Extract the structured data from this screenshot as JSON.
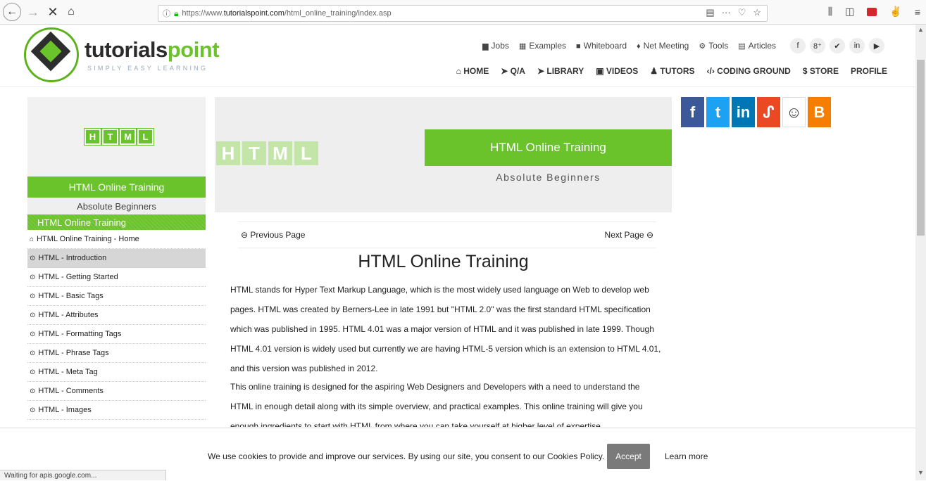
{
  "browser": {
    "url_prefix": "https://www.",
    "url_domain": "tutorialspoint.com",
    "url_path": "/html_online_training/index.asp",
    "status_text": "Waiting for apis.google.com..."
  },
  "header": {
    "logo_main": "tutorials",
    "logo_accent": "point",
    "logo_tagline": "SIMPLY EASY LEARNING",
    "top_links": [
      "Jobs",
      "Examples",
      "Whiteboard",
      "Net Meeting",
      "Tools",
      "Articles"
    ],
    "main_nav": [
      "HOME",
      "Q/A",
      "LIBRARY",
      "VIDEOS",
      "TUTORS",
      "CODING GROUND",
      "$ STORE",
      "PROFILE"
    ]
  },
  "sidebar": {
    "tiles": [
      "H",
      "T",
      "M",
      "L"
    ],
    "title": "HTML Online Training",
    "subtitle": "Absolute Beginners",
    "section_head": "HTML Online Training",
    "items": [
      "HTML Online Training - Home",
      "HTML - Introduction",
      "HTML - Getting Started",
      "HTML - Basic Tags",
      "HTML - Attributes",
      "HTML - Formatting Tags",
      "HTML - Phrase Tags",
      "HTML - Meta Tag",
      "HTML - Comments",
      "HTML - Images"
    ]
  },
  "banner": {
    "tiles": [
      "H",
      "T",
      "M",
      "L"
    ],
    "title": "HTML Online Training",
    "subtitle": "Absolute Beginners"
  },
  "content": {
    "prev_label": "Previous Page",
    "next_label": "Next Page",
    "title": "HTML Online Training",
    "para1": "HTML stands for Hyper Text Markup Language, which is the most widely used language on Web to develop web pages. HTML was created by Berners-Lee in late 1991 but \"HTML 2.0\" was the first standard HTML specification which was published in 1995. HTML 4.01 was a major version of HTML and it was published in late 1999. Though HTML 4.01 version is widely used but currently we are having HTML-5 version which is an extension to HTML 4.01, and this version was published in 2012.",
    "para2": "This online training is designed for the aspiring Web Designers and Developers with a need to understand the HTML in enough detail along with its simple overview, and practical examples. This online training will give you enough ingredients to start with HTML from where you can take yourself at higher level of expertise."
  },
  "cookie": {
    "text": "We use cookies to provide and improve our services. By using our site, you consent to our Cookies Policy.",
    "accept": "Accept",
    "learn_more": "Learn more"
  },
  "colors": {
    "brand_green": "#6bc32c",
    "accept_gray": "#7a7a7a"
  }
}
